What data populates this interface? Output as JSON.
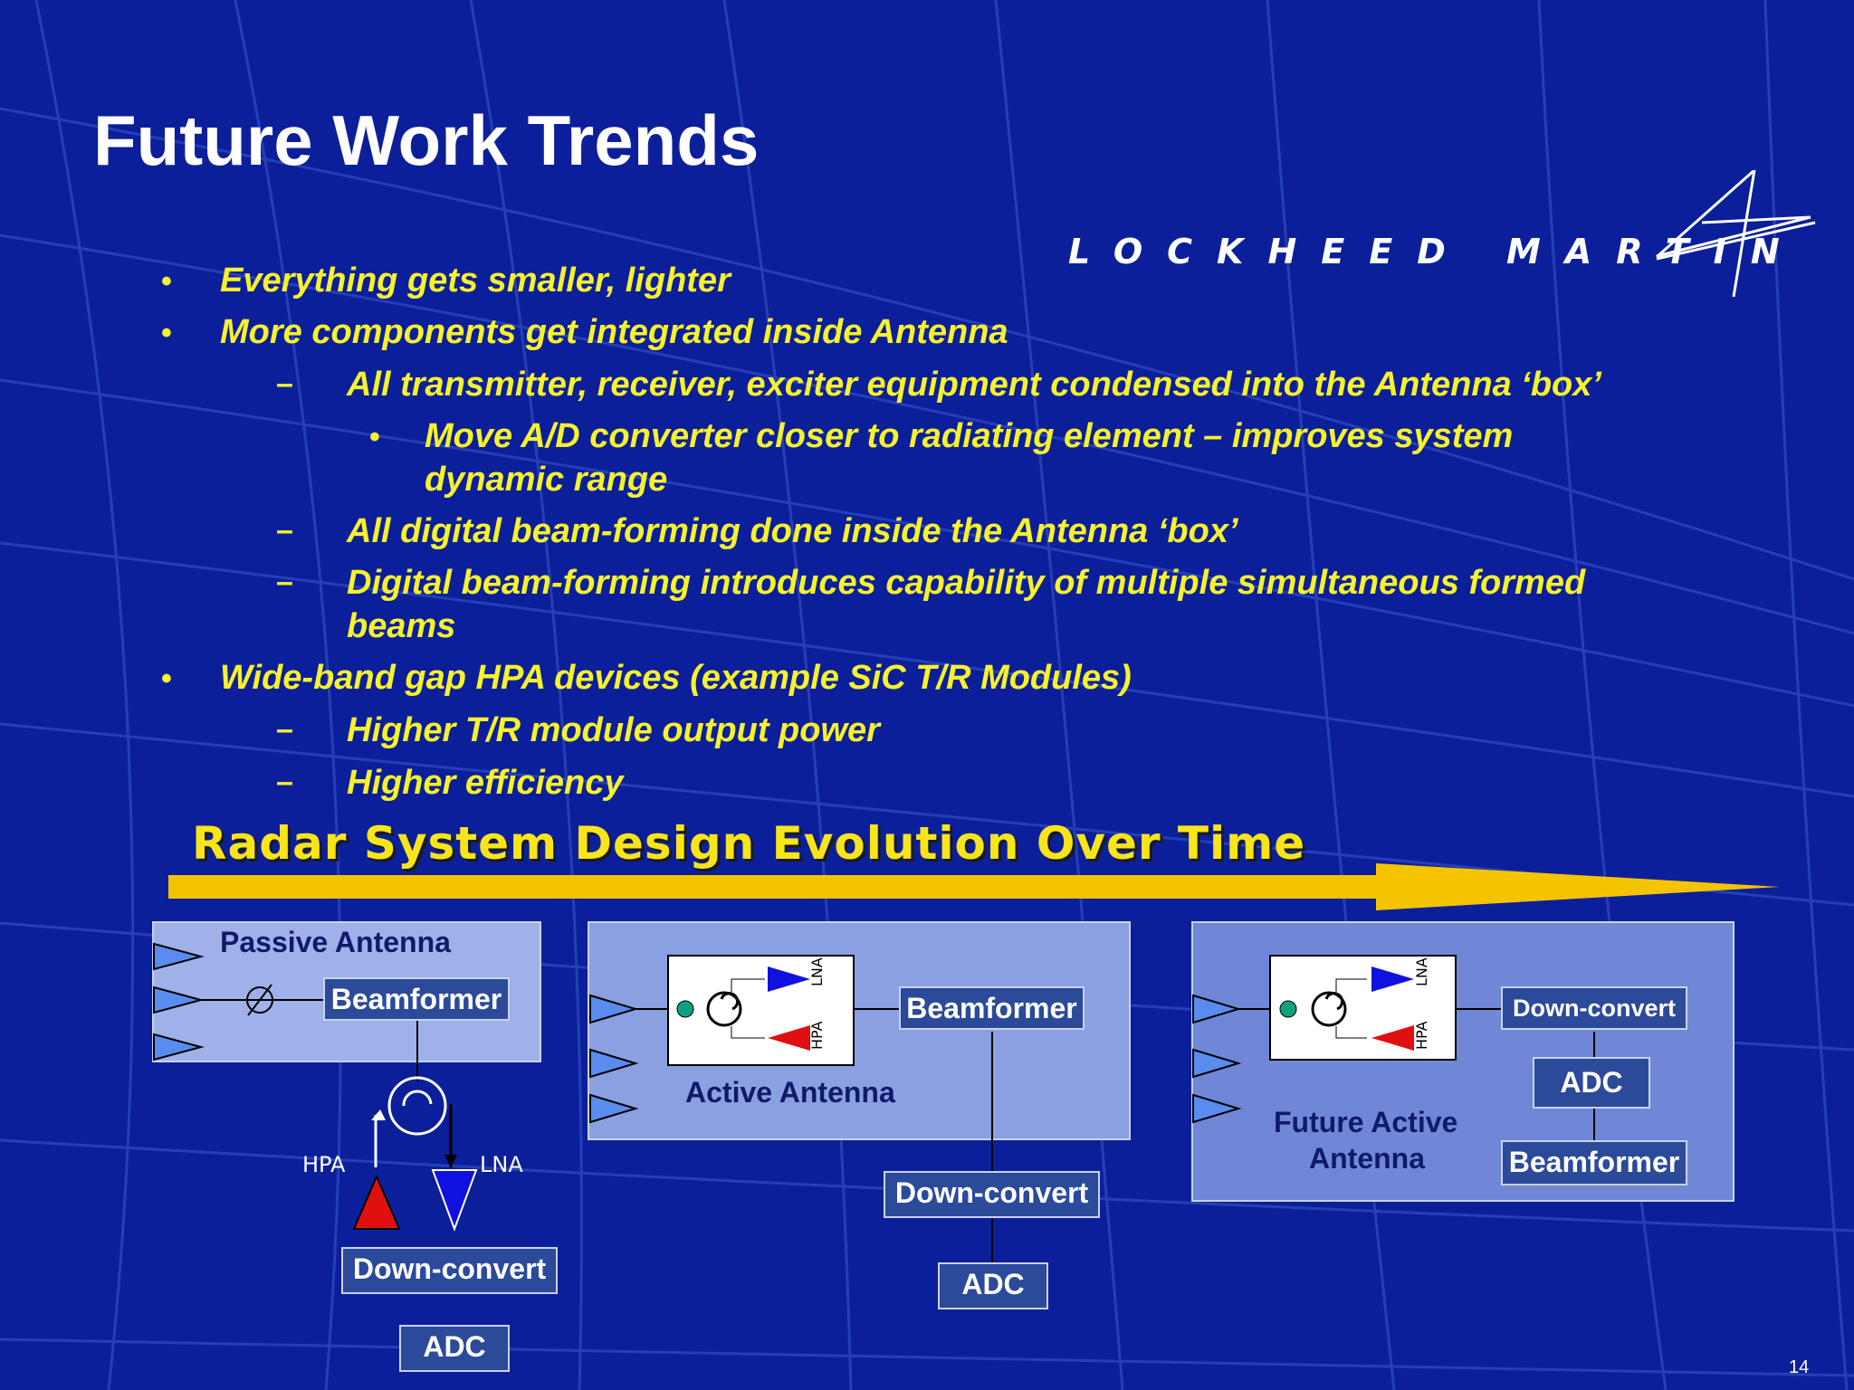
{
  "slide": {
    "title": "Future Work Trends",
    "page_number": "14"
  },
  "logo": {
    "text": "LOCKHEED MARTIN"
  },
  "bullets": [
    {
      "level": 1,
      "marker": "•",
      "text": "Everything gets smaller, lighter"
    },
    {
      "level": 1,
      "marker": "•",
      "text": "More components get integrated inside Antenna"
    },
    {
      "level": 2,
      "marker": "–",
      "text": "All transmitter, receiver, exciter equipment condensed into the Antenna ‘box’"
    },
    {
      "level": 3,
      "marker": "•",
      "text": "Move A/D converter closer to radiating element – improves system"
    },
    {
      "level": 3,
      "marker": "",
      "text": "dynamic range"
    },
    {
      "level": 2,
      "marker": "–",
      "text": "All digital beam-forming done inside the Antenna ‘box’"
    },
    {
      "level": 2,
      "marker": "–",
      "text": "Digital beam-forming introduces capability of multiple simultaneous formed"
    },
    {
      "level": 2,
      "marker": "",
      "text": "beams"
    },
    {
      "level": 1,
      "marker": "•",
      "text": "Wide-band gap HPA devices (example SiC T/R Modules)"
    },
    {
      "level": 2,
      "marker": "–",
      "text": "Higher T/R module output power"
    },
    {
      "level": 2,
      "marker": "–",
      "text": "Higher efficiency"
    }
  ],
  "evolution": {
    "title": "Radar System Design Evolution Over Time"
  },
  "passive": {
    "label": "Passive Antenna",
    "beamformer": "Beamformer",
    "hpa": "HPA",
    "lna": "LNA",
    "downconvert": "Down-convert",
    "adc": "ADC"
  },
  "active": {
    "label": "Active Antenna",
    "beamformer": "Beamformer",
    "lna": "LNA",
    "hpa": "HPA",
    "downconvert": "Down-convert",
    "adc": "ADC"
  },
  "future": {
    "label_line1": "Future Active",
    "label_line2": "Antenna",
    "lna": "LNA",
    "hpa": "HPA",
    "downconvert": "Down-convert",
    "adc": "ADC",
    "beamformer": "Beamformer"
  },
  "colors": {
    "background": "#0c1f9a",
    "bullet_text": "#f6f22c",
    "arrow": "#f5c400",
    "hpa_triangle": "#e01010",
    "lna_triangle": "#1010e0"
  }
}
